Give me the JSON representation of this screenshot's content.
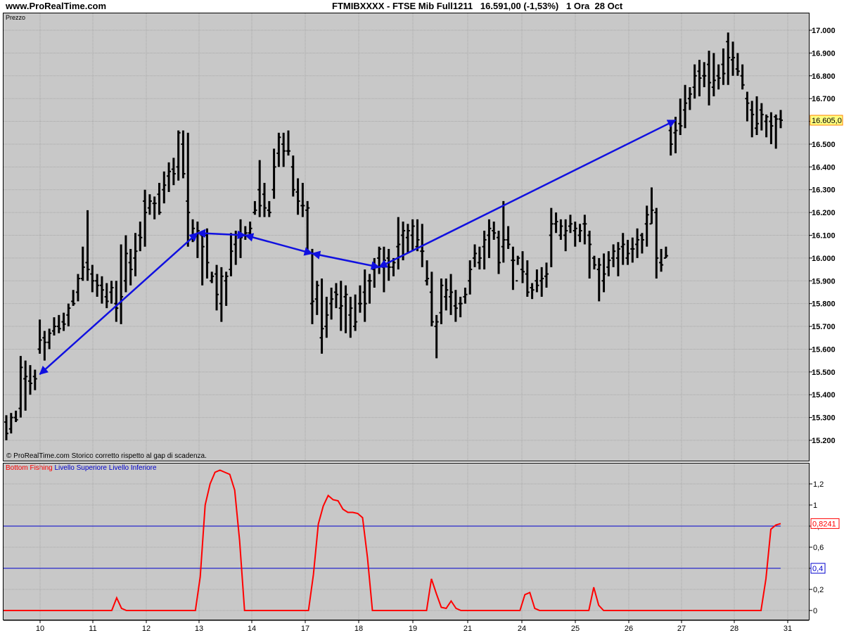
{
  "header": {
    "site": "www.ProRealTime.com",
    "title": "FTMIBXXXX - FTSE Mib Full1211   16.591,00 (-1,53%)   1 Ora  28 Oct"
  },
  "price_panel": {
    "label": "Prezzo",
    "footnote": "© ProRealTime.com  Storico corretto rispetto al gap di scadenza."
  },
  "indicator_panel": {
    "legend": [
      "Bottom Fishing",
      "Livello Superiore",
      "Livello Inferiore"
    ]
  },
  "colors": {
    "panel_bg": "#c8c8c8",
    "bars": "#000000",
    "trendline": "#1010e0",
    "indicator": "#ff0000",
    "level": "#0000cc",
    "label_price_bg": "#ffff80",
    "label_price_border": "#ff8000"
  },
  "chart_data": [
    {
      "type": "ohlc",
      "title": "FTMIBXXXX - FTSE Mib Full1211",
      "ylim": [
        15150,
        17030
      ],
      "yticks": [
        15200,
        15300,
        15400,
        15500,
        15600,
        15700,
        15800,
        15900,
        16000,
        16100,
        16200,
        16300,
        16400,
        16500,
        16600,
        16700,
        16800,
        16900,
        17000
      ],
      "ytick_labels": [
        "15.200",
        "15.300",
        "15.400",
        "15.500",
        "15.600",
        "15.700",
        "15.800",
        "15.900",
        "16.000",
        "16.100",
        "16.200",
        "16.300",
        "16.400",
        "16.500",
        "16.600",
        "16.700",
        "16.800",
        "16.900",
        "17.000"
      ],
      "xticks": [
        "10",
        "11",
        "12",
        "13",
        "14",
        "17",
        "18",
        "19",
        "21",
        "24",
        "25",
        "26",
        "27",
        "28",
        "31"
      ],
      "last_price_label": "16.605,0",
      "last_price": 16605,
      "bars": [
        [
          15280,
          15310,
          15200,
          15230
        ],
        [
          15250,
          15320,
          15230,
          15300
        ],
        [
          15300,
          15330,
          15280,
          15290
        ],
        [
          15340,
          15570,
          15300,
          15520
        ],
        [
          15470,
          15550,
          15330,
          15480
        ],
        [
          15460,
          15530,
          15400,
          15450
        ],
        [
          15480,
          15510,
          15420,
          15470
        ],
        [
          15600,
          15730,
          15580,
          15640
        ],
        [
          15650,
          15680,
          15550,
          15630
        ],
        [
          15630,
          15690,
          15600,
          15670
        ],
        [
          15680,
          15740,
          15660,
          15700
        ],
        [
          15700,
          15750,
          15670,
          15690
        ],
        [
          15720,
          15760,
          15680,
          15710
        ],
        [
          15750,
          15800,
          15700,
          15780
        ],
        [
          15810,
          15860,
          15790,
          15800
        ],
        [
          15850,
          15930,
          15810,
          15910
        ],
        [
          15910,
          16050,
          15900,
          15960
        ],
        [
          15980,
          16210,
          15900,
          15950
        ],
        [
          15930,
          15970,
          15850,
          15900
        ],
        [
          15900,
          15930,
          15830,
          15880
        ],
        [
          15880,
          15920,
          15800,
          15860
        ],
        [
          15830,
          15890,
          15780,
          15810
        ],
        [
          15850,
          15900,
          15800,
          15870
        ],
        [
          15800,
          15900,
          15720,
          15780
        ],
        [
          15800,
          16060,
          15710,
          15830
        ],
        [
          15900,
          16100,
          15850,
          16020
        ],
        [
          15980,
          16040,
          15880,
          15950
        ],
        [
          16000,
          16110,
          15920,
          16030
        ],
        [
          16100,
          16160,
          16030,
          16090
        ],
        [
          16250,
          16300,
          16050,
          16200
        ],
        [
          16220,
          16280,
          16190,
          16250
        ],
        [
          16240,
          16270,
          16170,
          16240
        ],
        [
          16280,
          16330,
          16190,
          16200
        ],
        [
          16300,
          16380,
          16240,
          16320
        ],
        [
          16360,
          16420,
          16290,
          16380
        ],
        [
          16390,
          16440,
          16320,
          16370
        ],
        [
          16400,
          16560,
          16340,
          16550
        ],
        [
          16500,
          16560,
          16350,
          16370
        ],
        [
          16250,
          16550,
          16050,
          16200
        ],
        [
          16100,
          16170,
          16070,
          16130
        ],
        [
          16100,
          16160,
          16000,
          16120
        ],
        [
          16100,
          16110,
          15880,
          16050
        ],
        [
          16100,
          16130,
          15910,
          15980
        ],
        [
          15900,
          15940,
          15890,
          15920
        ],
        [
          15930,
          15970,
          15770,
          15840
        ],
        [
          15800,
          15960,
          15720,
          15920
        ],
        [
          15900,
          15940,
          15790,
          15920
        ],
        [
          15950,
          16110,
          15920,
          16030
        ],
        [
          16060,
          16120,
          15970,
          16100
        ],
        [
          16100,
          16170,
          16000,
          16090
        ],
        [
          16100,
          16140,
          16080,
          16110
        ],
        [
          16110,
          16160,
          16100,
          16130
        ],
        [
          16200,
          16250,
          16190,
          16210
        ],
        [
          16300,
          16430,
          16180,
          16230
        ],
        [
          16280,
          16330,
          16180,
          16220
        ],
        [
          16210,
          16250,
          16180,
          16200
        ],
        [
          16300,
          16480,
          16260,
          16400
        ],
        [
          16460,
          16550,
          16400,
          16530
        ],
        [
          16500,
          16550,
          16400,
          16470
        ],
        [
          16470,
          16560,
          16450,
          16470
        ],
        [
          16400,
          16450,
          16270,
          16300
        ],
        [
          16290,
          16350,
          16190,
          16250
        ],
        [
          16230,
          16330,
          16180,
          16230
        ],
        [
          16210,
          16250,
          16020,
          16220
        ],
        [
          15800,
          16040,
          15710,
          15810
        ],
        [
          15820,
          15900,
          15750,
          15880
        ],
        [
          15650,
          15910,
          15580,
          15690
        ],
        [
          15700,
          15830,
          15650,
          15750
        ],
        [
          15800,
          15870,
          15730,
          15820
        ],
        [
          15850,
          15890,
          15780,
          15840
        ],
        [
          15780,
          15900,
          15680,
          15790
        ],
        [
          15830,
          15880,
          15670,
          15840
        ],
        [
          15750,
          15830,
          15650,
          15780
        ],
        [
          15700,
          15840,
          15680,
          15720
        ],
        [
          15800,
          15880,
          15760,
          15800
        ],
        [
          15850,
          15950,
          15720,
          15800
        ],
        [
          15900,
          15930,
          15800,
          15900
        ],
        [
          15950,
          16000,
          15870,
          15960
        ],
        [
          16000,
          16050,
          15930,
          16040
        ],
        [
          15960,
          16050,
          15850,
          15990
        ],
        [
          16000,
          16040,
          15900,
          15960
        ],
        [
          15960,
          16000,
          15920,
          15980
        ],
        [
          16050,
          16180,
          15950,
          16060
        ],
        [
          16100,
          16160,
          15990,
          16120
        ],
        [
          16090,
          16150,
          16020,
          16120
        ],
        [
          16100,
          16170,
          16030,
          16140
        ],
        [
          16050,
          16170,
          16030,
          16080
        ],
        [
          16030,
          16150,
          15960,
          16030
        ],
        [
          15900,
          15990,
          15880,
          15910
        ],
        [
          15850,
          15940,
          15700,
          15720
        ],
        [
          15700,
          15750,
          15560,
          15720
        ],
        [
          15760,
          15910,
          15710,
          15880
        ],
        [
          15830,
          15910,
          15770,
          15860
        ],
        [
          15830,
          15930,
          15750,
          15850
        ],
        [
          15790,
          15860,
          15720,
          15780
        ],
        [
          15800,
          15830,
          15740,
          15800
        ],
        [
          15830,
          15870,
          15800,
          15840
        ],
        [
          15900,
          15990,
          15840,
          15950
        ],
        [
          16000,
          16060,
          15960,
          16020
        ],
        [
          15980,
          16050,
          15950,
          16000
        ],
        [
          16050,
          16120,
          15950,
          16080
        ],
        [
          16100,
          16170,
          16000,
          16130
        ],
        [
          16120,
          16160,
          16080,
          16110
        ],
        [
          16090,
          16120,
          15930,
          15980
        ],
        [
          16050,
          16250,
          15980,
          16080
        ],
        [
          16080,
          16140,
          16040,
          16060
        ],
        [
          15990,
          16050,
          15860,
          15990
        ],
        [
          15900,
          16010,
          15970,
          16000
        ],
        [
          15950,
          16030,
          15890,
          15940
        ],
        [
          15930,
          15990,
          15830,
          15850
        ],
        [
          15870,
          15890,
          15820,
          15860
        ],
        [
          15900,
          15950,
          15850,
          15880
        ],
        [
          15900,
          15960,
          15830,
          15910
        ],
        [
          15920,
          15980,
          15870,
          15930
        ],
        [
          16100,
          16220,
          15960,
          16150
        ],
        [
          16150,
          16200,
          16110,
          16160
        ],
        [
          16100,
          16170,
          16080,
          16140
        ],
        [
          16100,
          16170,
          16030,
          16120
        ],
        [
          16140,
          16190,
          16110,
          16150
        ],
        [
          16120,
          16160,
          16050,
          16130
        ],
        [
          16100,
          16150,
          16070,
          16120
        ],
        [
          16150,
          16190,
          16060,
          16150
        ],
        [
          16100,
          16120,
          15910,
          16060
        ],
        [
          16000,
          16010,
          15950,
          15970
        ],
        [
          15950,
          16000,
          15810,
          15970
        ],
        [
          15900,
          16020,
          15850,
          15930
        ],
        [
          15960,
          16030,
          15920,
          15990
        ],
        [
          16000,
          16060,
          15960,
          16030
        ],
        [
          16000,
          16070,
          15920,
          16040
        ],
        [
          16050,
          16110,
          15970,
          16060
        ],
        [
          16000,
          16080,
          15970,
          16020
        ],
        [
          16040,
          16090,
          15980,
          16040
        ],
        [
          16060,
          16130,
          16000,
          16080
        ],
        [
          16100,
          16110,
          16020,
          16080
        ],
        [
          16150,
          16230,
          16050,
          16190
        ],
        [
          16150,
          16310,
          16150,
          16210
        ],
        [
          16200,
          16220,
          15910,
          16000
        ],
        [
          15980,
          16040,
          15940,
          15970
        ],
        [
          16000,
          16050,
          16000,
          16010
        ],
        [
          16560,
          16600,
          16450,
          16500
        ],
        [
          16550,
          16620,
          16460,
          16560
        ],
        [
          16590,
          16700,
          16540,
          16580
        ],
        [
          16650,
          16760,
          16570,
          16680
        ],
        [
          16700,
          16750,
          16650,
          16720
        ],
        [
          16750,
          16850,
          16700,
          16800
        ],
        [
          16820,
          16870,
          16710,
          16790
        ],
        [
          16800,
          16860,
          16750,
          16800
        ],
        [
          16850,
          16910,
          16670,
          16770
        ],
        [
          16750,
          16900,
          16710,
          16780
        ],
        [
          16800,
          16850,
          16740,
          16790
        ],
        [
          16850,
          16920,
          16760,
          16810
        ],
        [
          16950,
          16990,
          16760,
          16880
        ],
        [
          16870,
          16950,
          16800,
          16880
        ],
        [
          16830,
          16900,
          16800,
          16820
        ],
        [
          16800,
          16850,
          16740,
          16760
        ],
        [
          16700,
          16730,
          16600,
          16680
        ],
        [
          16650,
          16690,
          16530,
          16630
        ],
        [
          16570,
          16710,
          16540,
          16590
        ],
        [
          16650,
          16680,
          16560,
          16630
        ],
        [
          16600,
          16630,
          16530,
          16620
        ],
        [
          16600,
          16640,
          16500,
          16580
        ],
        [
          16620,
          16630,
          16480,
          16610
        ],
        [
          16610,
          16650,
          16570,
          16605
        ]
      ],
      "trendline": [
        {
          "bar": 7,
          "price": 15490
        },
        {
          "bar": 40,
          "price": 16110
        },
        {
          "bar": 50,
          "price": 16100
        },
        {
          "bar": 64,
          "price": 16020
        },
        {
          "bar": 78,
          "price": 15960
        },
        {
          "bar": 140,
          "price": 16605
        }
      ]
    },
    {
      "type": "line",
      "ylim": [
        -0.08,
        1.4
      ],
      "yticks": [
        0,
        0.2,
        0.4,
        0.6,
        0.8,
        1,
        1.2
      ],
      "ytick_labels": [
        "0",
        "0,2",
        "0,4",
        "0,6",
        "0,8",
        "1",
        "1,2"
      ],
      "series": [
        {
          "name": "Bottom Fishing",
          "values": [
            0,
            0,
            0,
            0,
            0,
            0,
            0,
            0,
            0,
            0,
            0,
            0,
            0,
            0,
            0,
            0,
            0,
            0,
            0,
            0,
            0,
            0,
            0,
            0.12,
            0.02,
            0,
            0,
            0,
            0,
            0,
            0,
            0,
            0,
            0,
            0,
            0,
            0,
            0,
            0,
            0,
            0.32,
            1.0,
            1.2,
            1.31,
            1.33,
            1.31,
            1.29,
            1.14,
            0.66,
            0,
            0,
            0,
            0,
            0,
            0,
            0,
            0,
            0,
            0,
            0,
            0,
            0,
            0,
            0.34,
            0.82,
            0.99,
            1.09,
            1.05,
            1.04,
            0.96,
            0.93,
            0.93,
            0.92,
            0.88,
            0.5,
            0,
            0,
            0,
            0,
            0,
            0,
            0,
            0,
            0,
            0,
            0,
            0,
            0.3,
            0.16,
            0.03,
            0.02,
            0.09,
            0.02,
            0,
            0,
            0,
            0,
            0,
            0,
            0,
            0,
            0,
            0,
            0,
            0,
            0,
            0.15,
            0.17,
            0.02,
            0,
            0,
            0,
            0,
            0,
            0,
            0,
            0,
            0,
            0,
            0,
            0.22,
            0.05,
            0,
            0,
            0,
            0,
            0,
            0,
            0,
            0,
            0,
            0,
            0,
            0,
            0,
            0,
            0,
            0,
            0,
            0,
            0,
            0,
            0,
            0,
            0,
            0,
            0,
            0,
            0,
            0,
            0,
            0,
            0,
            0,
            0,
            0.3,
            0.77,
            0.81,
            0.8241
          ]
        },
        {
          "name": "Livello Superiore",
          "value": 0.8
        },
        {
          "name": "Livello Inferiore",
          "value": 0.4
        }
      ],
      "last_value_label": "0,8241",
      "lower_level_label": "0,4"
    }
  ]
}
